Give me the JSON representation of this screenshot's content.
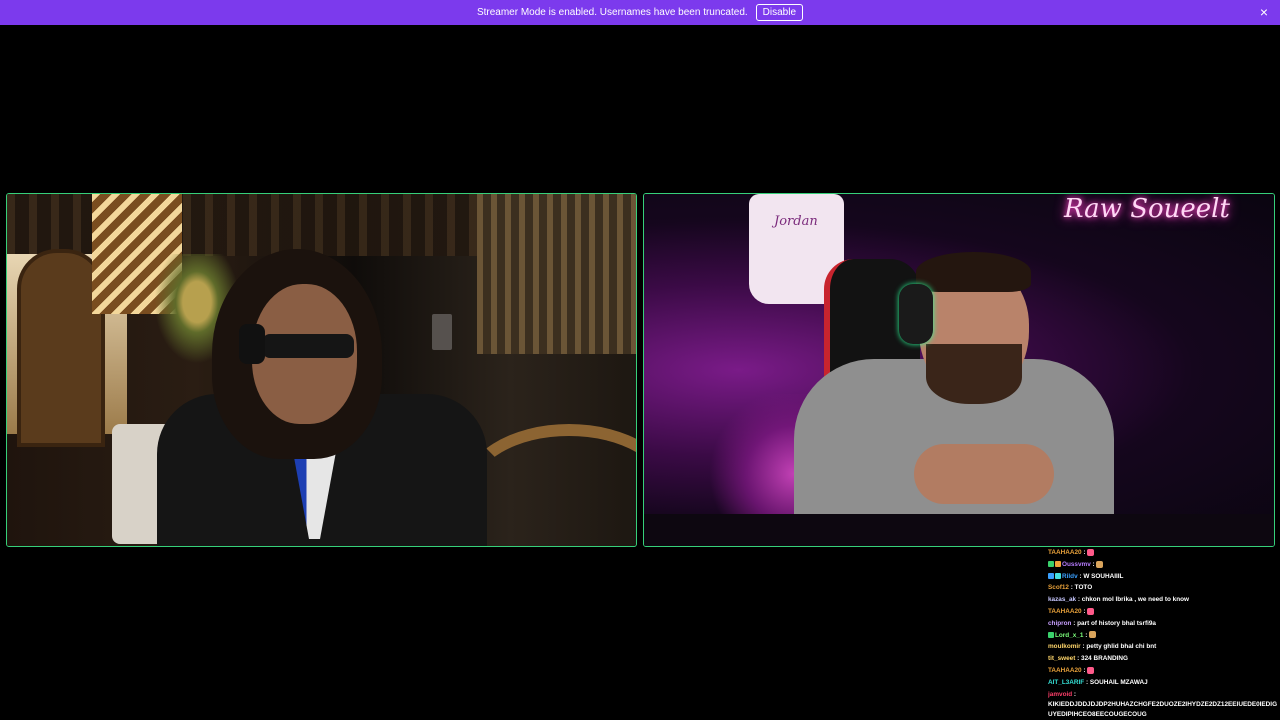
{
  "banner": {
    "message": "Streamer Mode is enabled. Usernames have been truncated.",
    "disable_label": "Disable",
    "close_icon": "×",
    "background": "#7c3aed"
  },
  "video": {
    "border_color": "#36d07a",
    "right_neon_sign": "Raw Soueelt",
    "right_shirt_text": "Jordan"
  },
  "chat": {
    "messages": [
      {
        "user": "TAAHAA20",
        "user_color": "#e8a13a",
        "text": "",
        "emote": "rocket-emote",
        "badges": []
      },
      {
        "user": "Oussvmv",
        "user_color": "#b77cff",
        "text": "",
        "emote": "face-emote",
        "badges": [
          "badge-green",
          "badge-orange"
        ]
      },
      {
        "user": "Rildv",
        "user_color": "#3aa0ff",
        "text": "W SOUHAIIIL",
        "emote": "",
        "badges": [
          "badge-blue",
          "badge-cyan"
        ]
      },
      {
        "user": "Scof12",
        "user_color": "#e8a13a",
        "text": "TOTO",
        "emote": "",
        "badges": []
      },
      {
        "user": "kazas_ak",
        "user_color": "#c8c8ff",
        "text": "chkon mol lbrika , we need to know",
        "emote": "",
        "badges": []
      },
      {
        "user": "TAAHAA20",
        "user_color": "#e8a13a",
        "text": "",
        "emote": "rocket-emote",
        "badges": []
      },
      {
        "user": "chipron",
        "user_color": "#c8a0ff",
        "text": "part of history bhal tsrfi9a",
        "emote": "",
        "badges": []
      },
      {
        "user": "Lord_x_1",
        "user_color": "#7cff7c",
        "text": "",
        "emote": "face-emote",
        "badges": [
          "badge-green"
        ]
      },
      {
        "user": "moulkomir",
        "user_color": "#ffd66b",
        "text": "petty ghlid bhal chi bnt",
        "emote": "",
        "badges": []
      },
      {
        "user": "tit_sweet",
        "user_color": "#ffd66b",
        "text": "324 BRANDING",
        "emote": "",
        "badges": []
      },
      {
        "user": "TAAHAA20",
        "user_color": "#e8a13a",
        "text": "",
        "emote": "rocket-emote",
        "badges": []
      },
      {
        "user": "AIT_L3ARIF",
        "user_color": "#35e0d6",
        "text": "SOUHAIL MZAWAJ",
        "emote": "",
        "badges": []
      },
      {
        "user": "jamvoid",
        "user_color": "#ff3f6a",
        "text": "KIKIEDDJDDJDJDP2HUHAZCHGFE2DUOZE2IHYDZE2DZ12EEIUEDE0IEDIGUYEDIPIHCEO8EECOUGECOUG",
        "emote": "",
        "badges": [],
        "long": true
      }
    ]
  }
}
